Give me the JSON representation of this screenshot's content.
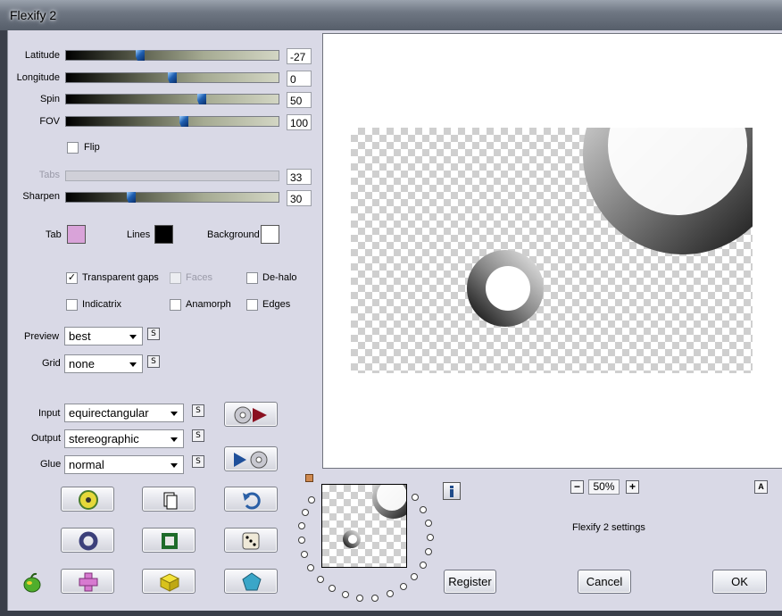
{
  "window": {
    "title": "Flexify 2"
  },
  "sliders": [
    {
      "label": "Latitude",
      "value": "-27",
      "level": 0.34,
      "disabled": false
    },
    {
      "label": "Longitude",
      "value": "0",
      "level": 0.5,
      "disabled": false
    },
    {
      "label": "Spin",
      "value": "50",
      "level": 0.64,
      "disabled": false
    },
    {
      "label": "FOV",
      "value": "100",
      "level": 0.54,
      "disabled": false
    }
  ],
  "flip": {
    "label": "Flip",
    "checked": false
  },
  "tabs_slider": {
    "label": "Tabs",
    "value": "33",
    "disabled": true
  },
  "sharpen": {
    "label": "Sharpen",
    "value": "30",
    "level": 0.3
  },
  "colors": {
    "tab": {
      "label": "Tab",
      "value": "#d9a3d9"
    },
    "lines": {
      "label": "Lines",
      "value": "#000000"
    },
    "background": {
      "label": "Background",
      "value": "#ffffff"
    }
  },
  "options": {
    "transparent_gaps": {
      "label": "Transparent gaps",
      "checked": true
    },
    "faces": {
      "label": "Faces",
      "checked": false,
      "disabled": true
    },
    "de_halo": {
      "label": "De-halo",
      "checked": false
    },
    "indicatrix": {
      "label": "Indicatrix",
      "checked": false
    },
    "anamorph": {
      "label": "Anamorph",
      "checked": false
    },
    "edges": {
      "label": "Edges",
      "checked": false
    }
  },
  "preview_select": {
    "label": "Preview",
    "value": "best"
  },
  "grid_select": {
    "label": "Grid",
    "value": "none"
  },
  "input_select": {
    "label": "Input",
    "value": "equirectangular"
  },
  "output_select": {
    "label": "Output",
    "value": "stereographic"
  },
  "glue_select": {
    "label": "Glue",
    "value": "normal"
  },
  "link_glyph": "S",
  "zoom": {
    "minus": "−",
    "value": "50%",
    "plus": "+"
  },
  "info_label": "Flexify 2 settings",
  "buttons": {
    "register": "Register",
    "cancel": "Cancel",
    "ok": "OK"
  },
  "about_glyph": "A"
}
